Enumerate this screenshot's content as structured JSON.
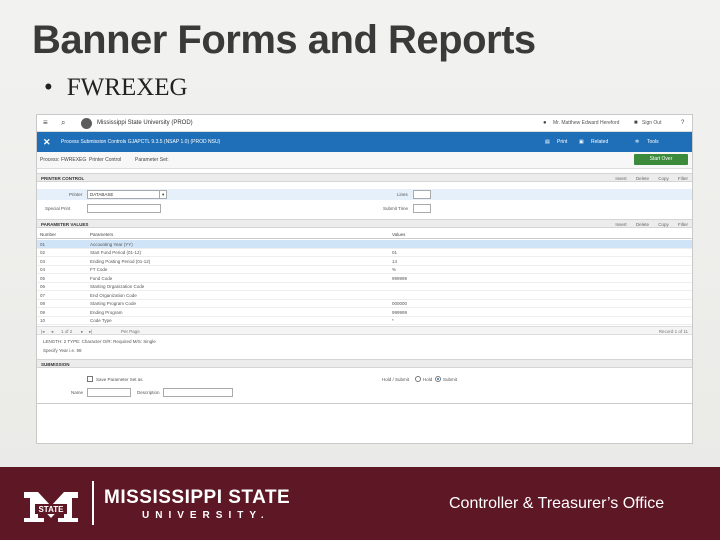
{
  "slide": {
    "title": "Banner Forms and Reports",
    "bullet": "FWREXEG"
  },
  "banner": {
    "topbar": {
      "institution": "Mississippi State University (PROD)",
      "user": "Mr. Matthew Edward Hereford",
      "sign_out": "Sign Out",
      "help": "?"
    },
    "form_title": "Process Submission Controls GJAPCTL 9.3.5 (NSAP 1.0) (PROD NSU)",
    "actions": [
      "Print",
      "Related",
      "Tools"
    ],
    "key_block": {
      "process_label": "Process:",
      "process_value": "FWREXEG",
      "printer_label": "Printer Control",
      "param_set_label": "Parameter Set:",
      "start_over": "Start Over"
    },
    "printer_section": {
      "title": "PRINTER CONTROL",
      "printer_label": "Printer",
      "printer_value": "DATABASE",
      "special_print_label": "Special Print",
      "lines_label": "Lines",
      "submit_time_label": "Submit Time",
      "tools": [
        "Insert",
        "Delete",
        "Copy",
        "Filter"
      ]
    },
    "param_section": {
      "title": "PARAMETER VALUES",
      "col_number": "Number",
      "col_parameters": "Parameters",
      "col_values": "Values",
      "tools": [
        "Insert",
        "Delete",
        "Copy",
        "Filter"
      ],
      "rows": [
        {
          "num": "01",
          "param": "Accounting Year (YY)",
          "value": ""
        },
        {
          "num": "02",
          "param": "Start Fund Period (01-12)",
          "value": "01"
        },
        {
          "num": "03",
          "param": "Ending Posting Period (01-12)",
          "value": "14"
        },
        {
          "num": "04",
          "param": "FT Code",
          "value": "%"
        },
        {
          "num": "05",
          "param": "Fund Code",
          "value": "999999"
        },
        {
          "num": "06",
          "param": "Starting Organization Code",
          "value": ""
        },
        {
          "num": "07",
          "param": "End Organization Code",
          "value": ""
        },
        {
          "num": "08",
          "param": "Starting Program Code",
          "value": "000000"
        },
        {
          "num": "09",
          "param": "Ending Program",
          "value": "999999"
        },
        {
          "num": "10",
          "param": "Code Type",
          "value": "*"
        }
      ]
    },
    "pager": {
      "page_text": "1 of 2",
      "per_page": "Per Page",
      "record": "Record 1 of 11"
    },
    "notes": {
      "length": "LENGTH: 2 TYPE: Character O/R: Required M/S: Single",
      "specify": "Specify Year i.e. 98"
    },
    "submission": {
      "title": "SUBMISSION",
      "save_label": "Save Parameter Set as",
      "hold_label": "Hold / Submit",
      "hold_opt": "Hold",
      "submit_opt": "Submit",
      "name_label": "Name",
      "description_label": "Description"
    }
  },
  "footer": {
    "university_line1": "MISSISSIPPI STATE",
    "university_line2": "UNIVERSITY.",
    "badge_text": "STATE",
    "office": "Controller & Treasurer’s Office"
  }
}
